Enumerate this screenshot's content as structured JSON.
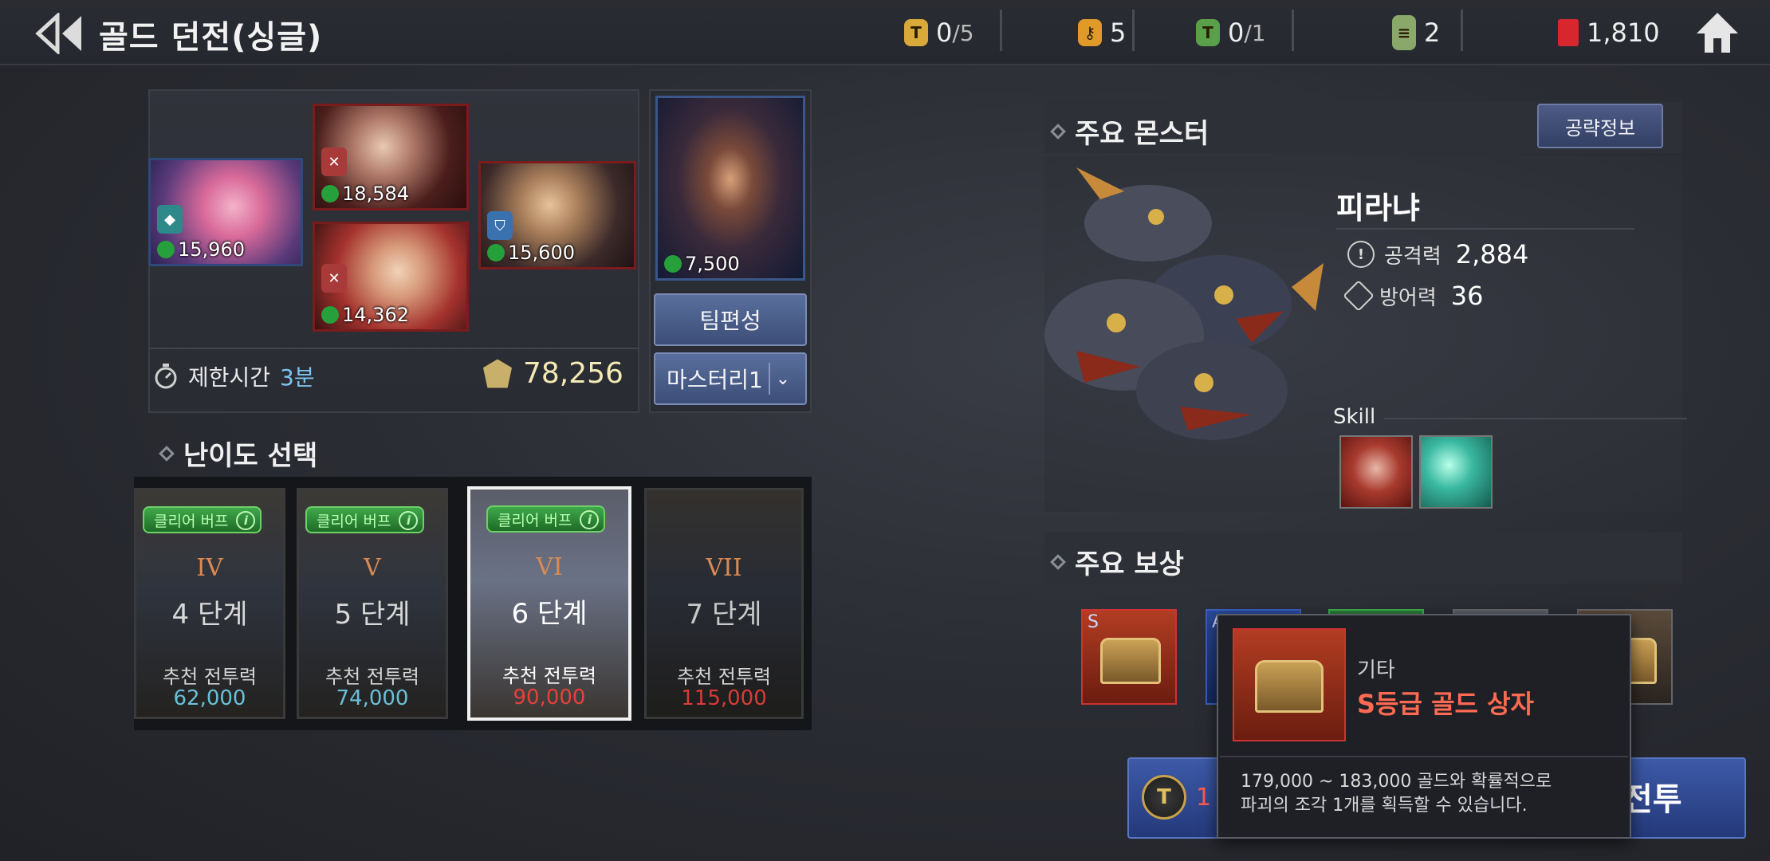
{
  "header": {
    "title": "골드 던전(싱글)",
    "currencies": [
      {
        "name": "ticket-gold",
        "value": "0",
        "max": "/5",
        "color": "#d9a93a"
      },
      {
        "name": "key",
        "value": "5",
        "max": "",
        "color": "#e09a2a"
      },
      {
        "name": "ticket-green",
        "value": "0",
        "max": "/1",
        "color": "#5aa04a"
      },
      {
        "name": "scroll",
        "value": "2",
        "max": "",
        "color": "#8aa86a"
      },
      {
        "name": "ruby",
        "value": "1,810",
        "max": "",
        "color": "#d8262e"
      }
    ]
  },
  "party": {
    "heroes": [
      {
        "power": "15,960"
      },
      {
        "power": "18,584"
      },
      {
        "power": "14,362"
      },
      {
        "power": "15,600"
      }
    ],
    "support": {
      "power": "7,500"
    },
    "time_limit_label": "제한시간",
    "time_limit_value": "3분",
    "total_power": "78,256",
    "team_button": "팀편성",
    "mastery_selected": "마스터리1"
  },
  "difficulty": {
    "title": "난이도 선택",
    "rec_label": "추천 전투력",
    "buff_label": "클리어 버프",
    "levels": [
      {
        "roman": "IV",
        "stage": "4 단계",
        "rec_power": "62,000",
        "color": "#6ac0d6"
      },
      {
        "roman": "V",
        "stage": "5 단계",
        "rec_power": "74,000",
        "color": "#6ac0d6"
      },
      {
        "roman": "VI",
        "stage": "6 단계",
        "rec_power": "90,000",
        "color": "#e8403a"
      },
      {
        "roman": "VII",
        "stage": "7 단계",
        "rec_power": "115,000",
        "color": "#d83c36"
      }
    ]
  },
  "monster": {
    "section_title": "주요 몬스터",
    "guide_button": "공략정보",
    "name": "피라냐",
    "attack_label": "공격력",
    "attack_value": "2,884",
    "defense_label": "방어력",
    "defense_value": "36",
    "skill_label": "Skill"
  },
  "rewards": {
    "section_title": "주요 보상",
    "first_grade": "S",
    "second_grade": "A"
  },
  "tooltip": {
    "category": "기타",
    "name": "S등급 골드 상자",
    "description_line1": "179,000 ~ 183,000 골드와 확률적으로",
    "description_line2": "파괴의 조각 1개를 획득할 수 있습니다."
  },
  "start": {
    "cost": "1",
    "label": "전투"
  }
}
